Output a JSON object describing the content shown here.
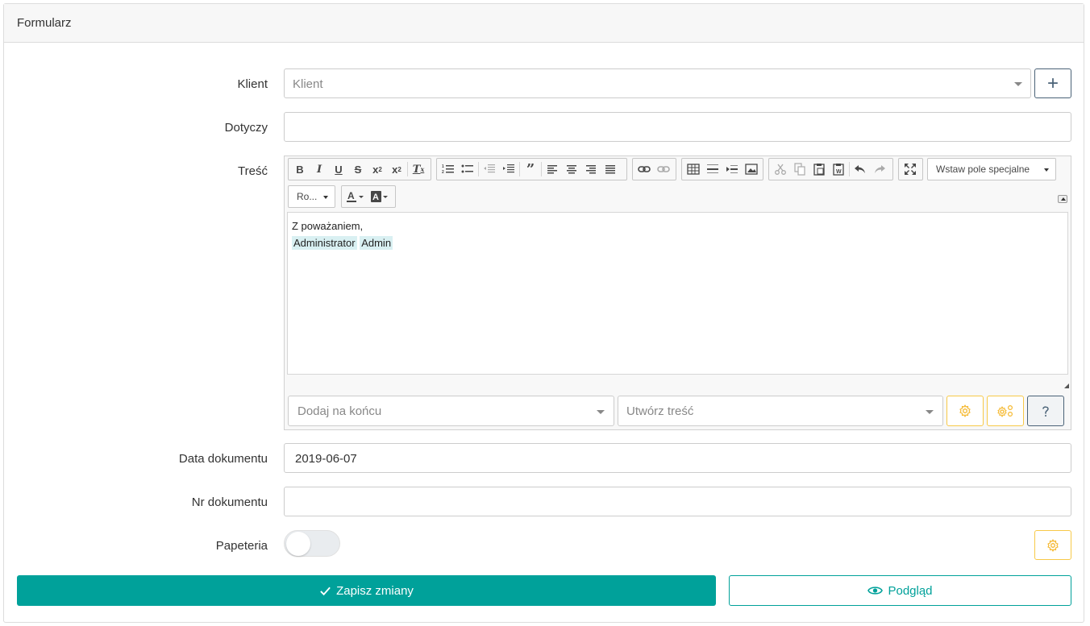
{
  "header": {
    "title": "Formularz"
  },
  "form": {
    "client": {
      "label": "Klient",
      "placeholder": "Klient",
      "add_label": "+"
    },
    "subject": {
      "label": "Dotyczy",
      "value": ""
    },
    "content": {
      "label": "Treść",
      "special_field_label": "Wstaw pole specjalne",
      "font_label": "Ro...",
      "body_line1": "Z poważaniem,",
      "tag1": "Administrator",
      "tag2": "Admin",
      "append_placeholder": "Dodaj na końcu",
      "create_placeholder": "Utwórz treść"
    },
    "doc_date": {
      "label": "Data dokumentu",
      "value": "2019-06-07"
    },
    "doc_number": {
      "label": "Nr dokumentu",
      "value": ""
    },
    "letterhead": {
      "label": "Papeteria",
      "enabled": false
    }
  },
  "actions": {
    "save_label": "Zapisz zmiany",
    "preview_label": "Podgląd"
  },
  "colors": {
    "primary": "#00a19a",
    "warning": "#f7c948",
    "dark": "#4a6277"
  }
}
